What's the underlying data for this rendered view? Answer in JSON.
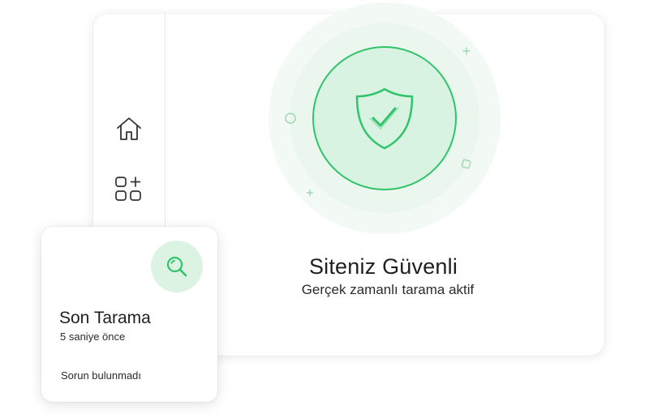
{
  "status": {
    "title": "Siteniz Güvenli",
    "subtitle": "Gerçek zamanlı tarama aktif"
  },
  "scan_card": {
    "title": "Son Tarama",
    "time": "5 saniye önce",
    "result": "Sorun bulunmadı"
  },
  "sidebar": {
    "items": [
      {
        "icon": "home-icon"
      },
      {
        "icon": "apps-add-icon"
      }
    ]
  },
  "colors": {
    "accent": "#2fc46a",
    "accent_light": "#d9f3e2",
    "glow": "#eaf6ee"
  }
}
